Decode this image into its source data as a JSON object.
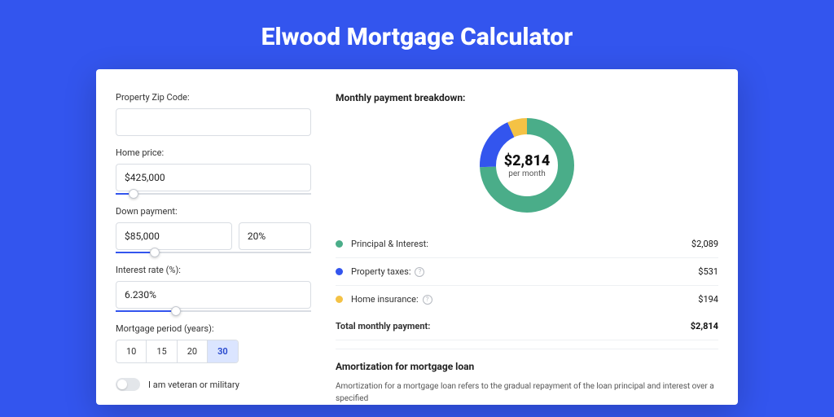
{
  "title": "Elwood Mortgage Calculator",
  "form": {
    "zip_label": "Property Zip Code:",
    "zip_value": "",
    "price_label": "Home price:",
    "price_value": "$425,000",
    "price_pct": 9,
    "down_label": "Down payment:",
    "down_value": "$85,000",
    "down_pct_value": "20%",
    "down_slider_pct": 20,
    "rate_label": "Interest rate (%):",
    "rate_value": "6.230%",
    "rate_slider_pct": 31,
    "period_label": "Mortgage period (years):",
    "periods": [
      "10",
      "15",
      "20",
      "30"
    ],
    "period_selected": 3,
    "veteran_label": "I am veteran or military",
    "veteran_on": false
  },
  "breakdown": {
    "title": "Monthly payment breakdown:",
    "center_amount": "$2,814",
    "center_unit": "per month",
    "items": [
      {
        "label": "Principal & Interest:",
        "value": "$2,089",
        "color": "#49a d",
        "c": "#4aad89",
        "num": 2089,
        "info": false
      },
      {
        "label": "Property taxes:",
        "value": "$531",
        "color": "#",
        "c": "#3355ee",
        "num": 531,
        "info": true
      },
      {
        "label": "Home insurance:",
        "value": "$194",
        "color": "#",
        "c": "#f4c245",
        "num": 194,
        "info": true
      }
    ],
    "total_label": "Total monthly payment:",
    "total_value": "$2,814"
  },
  "chart_data": {
    "type": "pie",
    "title": "Monthly payment breakdown",
    "series": [
      {
        "name": "Principal & Interest",
        "value": 2089,
        "color": "#4aad89"
      },
      {
        "name": "Property taxes",
        "value": 531,
        "color": "#3355ee"
      },
      {
        "name": "Home insurance",
        "value": 194,
        "color": "#f4c245"
      }
    ],
    "total": 2814,
    "center_label": "$2,814 per month"
  },
  "amort": {
    "title": "Amortization for mortgage loan",
    "text": "Amortization for a mortgage loan refers to the gradual repayment of the loan principal and interest over a specified"
  }
}
